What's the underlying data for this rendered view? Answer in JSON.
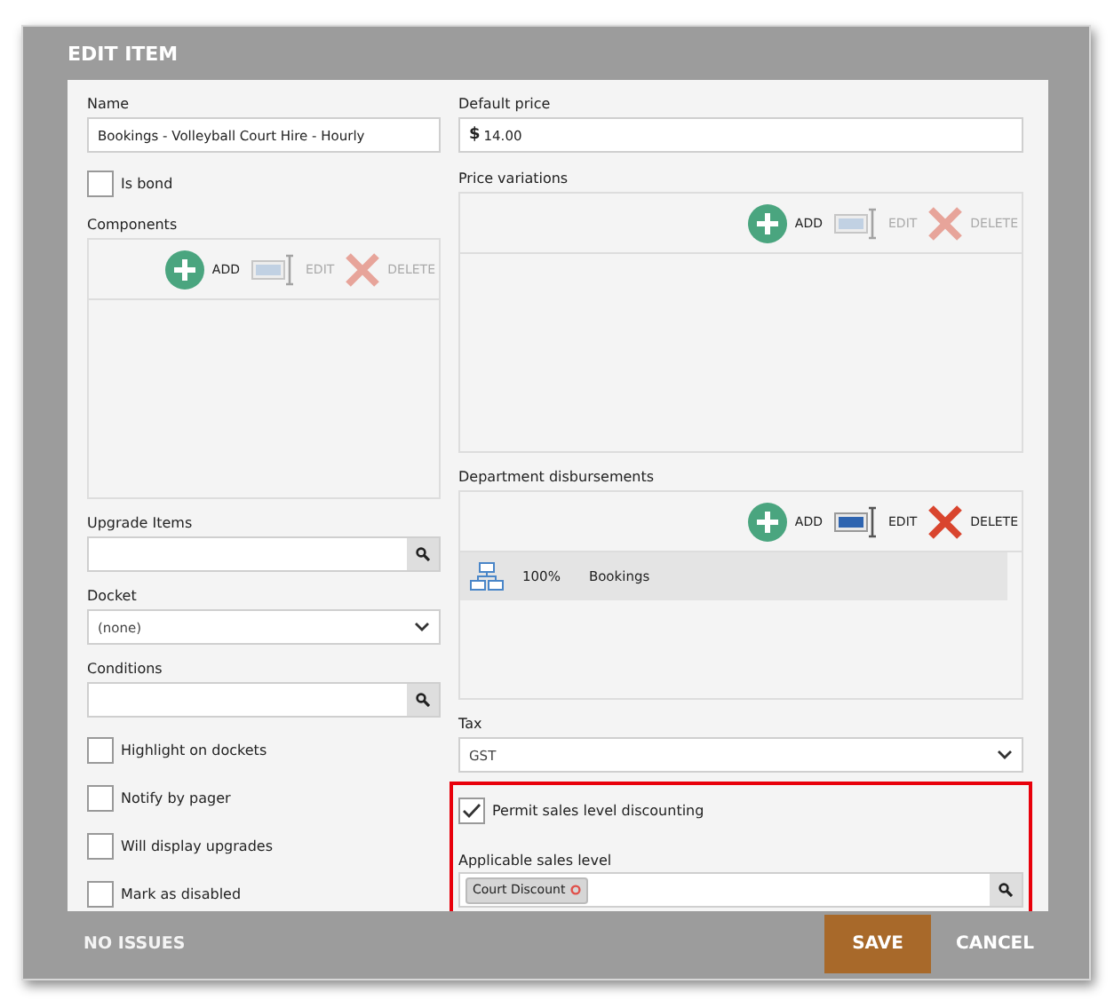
{
  "window": {
    "title": "EDIT ITEM"
  },
  "left": {
    "name": {
      "label": "Name",
      "value": "Bookings - Volleyball Court Hire - Hourly"
    },
    "is_bond": {
      "label": "Is bond",
      "checked": false
    },
    "components": {
      "label": "Components",
      "toolbar": [
        {
          "kind": "add",
          "label": "ADD",
          "disabled": false
        },
        {
          "kind": "edit",
          "label": "EDIT",
          "disabled": true
        },
        {
          "kind": "delete",
          "label": "DELETE",
          "disabled": true
        }
      ]
    },
    "upgrade_items": {
      "label": "Upgrade Items"
    },
    "docket": {
      "label": "Docket",
      "value": "(none)"
    },
    "conditions": {
      "label": "Conditions"
    },
    "options": [
      {
        "label": "Highlight on dockets",
        "checked": false
      },
      {
        "label": "Notify by pager",
        "checked": false
      },
      {
        "label": "Will display upgrades",
        "checked": false
      },
      {
        "label": "Mark as disabled",
        "checked": false
      }
    ]
  },
  "right": {
    "default_price": {
      "label": "Default price",
      "currency": "$",
      "value": "14.00"
    },
    "price_variations": {
      "label": "Price variations",
      "toolbar": [
        {
          "kind": "add",
          "label": "ADD",
          "disabled": false
        },
        {
          "kind": "edit",
          "label": "EDIT",
          "disabled": true
        },
        {
          "kind": "delete",
          "label": "DELETE",
          "disabled": true
        }
      ]
    },
    "department_disbursements": {
      "label": "Department disbursements",
      "toolbar": [
        {
          "kind": "add",
          "label": "ADD",
          "disabled": false
        },
        {
          "kind": "edit",
          "label": "EDIT",
          "disabled": false
        },
        {
          "kind": "delete",
          "label": "DELETE",
          "disabled": false
        }
      ],
      "rows": [
        {
          "percent": "100%",
          "department": "Bookings",
          "selected": true
        }
      ]
    },
    "tax": {
      "label": "Tax",
      "value": "GST"
    },
    "sales_section": {
      "highlighted": true,
      "permit": {
        "label": "Permit sales level discounting",
        "checked": true
      },
      "applicable": {
        "label": "Applicable sales level",
        "tags": [
          "Court Discount"
        ]
      }
    }
  },
  "footer": {
    "status": "NO ISSUES",
    "buttons": [
      {
        "kind": "primary",
        "label": "SAVE"
      },
      {
        "kind": "secondary",
        "label": "CANCEL"
      }
    ]
  }
}
